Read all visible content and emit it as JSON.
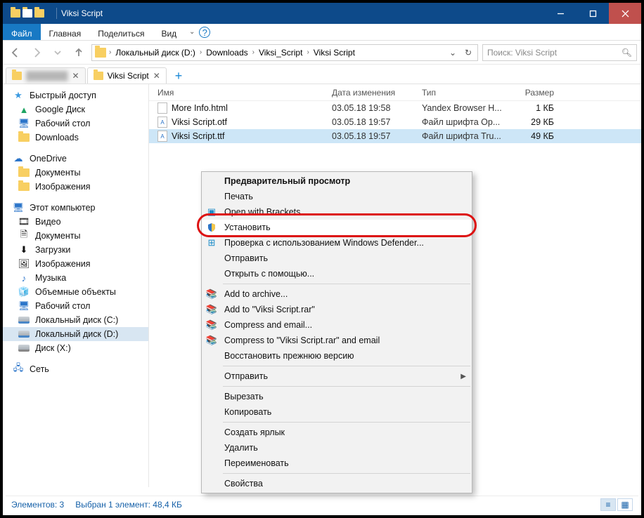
{
  "window": {
    "title": "Viksi Script"
  },
  "ribbon": {
    "file": "Файл",
    "home": "Главная",
    "share": "Поделиться",
    "view": "Вид"
  },
  "breadcrumb": [
    "Локальный диск (D:)",
    "Downloads",
    "Viksi_Script",
    "Viksi Script"
  ],
  "search": {
    "placeholder": "Поиск: Viksi Script"
  },
  "tabs": [
    {
      "label": "███████",
      "active": false,
      "blur": true
    },
    {
      "label": "Viksi Script",
      "active": true,
      "blur": false
    }
  ],
  "sidebar": {
    "quick": "Быстрый доступ",
    "quick_items": [
      "Google Диск",
      "Рабочий стол",
      "Downloads"
    ],
    "onedrive": "OneDrive",
    "onedrive_items": [
      "Документы",
      "Изображения"
    ],
    "thispc": "Этот компьютер",
    "pc_items": [
      "Видео",
      "Документы",
      "Загрузки",
      "Изображения",
      "Музыка",
      "Объемные объекты",
      "Рабочий стол",
      "Локальный диск (C:)",
      "Локальный диск (D:)",
      "Диск (X:)"
    ],
    "network": "Сеть"
  },
  "columns": {
    "name": "Имя",
    "date": "Дата изменения",
    "type": "Тип",
    "size": "Размер"
  },
  "files": [
    {
      "name": "More Info.html",
      "date": "03.05.18 19:58",
      "type": "Yandex Browser H...",
      "size": "1 КБ",
      "sel": false,
      "ic": ""
    },
    {
      "name": "Viksi Script.otf",
      "date": "03.05.18 19:57",
      "type": "Файл шрифта Op...",
      "size": "29 КБ",
      "sel": false,
      "ic": "A"
    },
    {
      "name": "Viksi Script.ttf",
      "date": "03.05.18 19:57",
      "type": "Файл шрифта Tru...",
      "size": "49 КБ",
      "sel": true,
      "ic": "A"
    }
  ],
  "context_menu": {
    "preview": "Предварительный просмотр",
    "print": "Печать",
    "brackets": "Open with Brackets",
    "install": "Установить",
    "defender": "Проверка с использованием Windows Defender...",
    "send": "Отправить",
    "openwith": "Открыть с помощью...",
    "addarchive": "Add to archive...",
    "addrar": "Add to \"Viksi Script.rar\"",
    "compressemail": "Compress and email...",
    "compressraremail": "Compress to \"Viksi Script.rar\" and email",
    "restore": "Восстановить прежнюю версию",
    "sendto": "Отправить",
    "cut": "Вырезать",
    "copy": "Копировать",
    "shortcut": "Создать ярлык",
    "delete": "Удалить",
    "rename": "Переименовать",
    "properties": "Свойства"
  },
  "status": {
    "items": "Элементов: 3",
    "selected": "Выбран 1 элемент: 48,4 КБ"
  }
}
